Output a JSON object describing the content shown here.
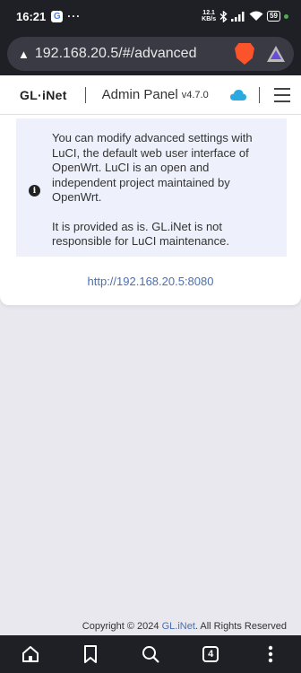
{
  "statusbar": {
    "time": "16:21",
    "g_badge": "G",
    "more": "···",
    "speed_value": "12.1",
    "speed_unit": "KB/s",
    "battery": "59"
  },
  "browser": {
    "url": "192.168.20.5/#/advanced",
    "tab_count": "4"
  },
  "header": {
    "logo": "GL·iNet",
    "title": "Admin Panel",
    "version": "v4.7.0"
  },
  "notice": {
    "paragraph1": "You can modify advanced settings with LuCI, the default web user interface of OpenWrt. LuCI is an open and independent project maintained by OpenWrt.",
    "paragraph2": "It is provided as is. GL.iNet is not responsible for LuCI maintenance.",
    "icon": "i"
  },
  "luci_link": "http://192.168.20.5:8080",
  "footer": {
    "prefix": "Copyright © 2024 ",
    "brand": "GL.iNet",
    "suffix": ". All Rights Reserved"
  },
  "colors": {
    "accent": "#4a6fb3",
    "notice_bg": "#eef1fb",
    "cloud": "#29a9e0",
    "brave": "#fb542b"
  }
}
